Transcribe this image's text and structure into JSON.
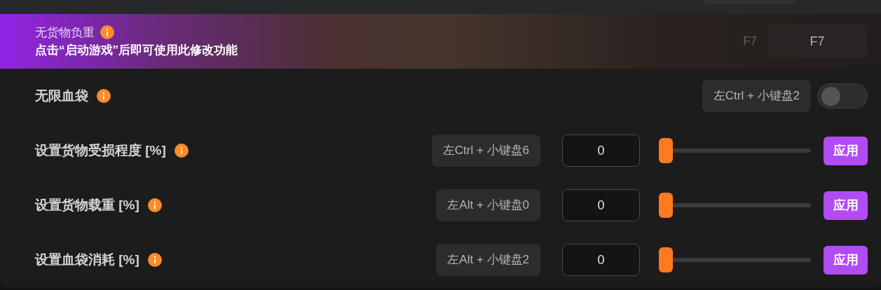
{
  "rows": [
    {
      "kind": "locked",
      "label": "无货物负重",
      "notice": "点击“启动游戏”后即可使用此修改功能",
      "hotkey": "F7",
      "key_button": "F7"
    },
    {
      "kind": "toggle",
      "label": "无限血袋",
      "hotkey": "左Ctrl + 小键盘2",
      "on": false
    },
    {
      "kind": "slider",
      "label": "设置货物受损程度 [%]",
      "hotkey": "左Ctrl + 小键盘6",
      "value": "0",
      "level": 0,
      "button": "应用"
    },
    {
      "kind": "slider",
      "label": "设置货物载重 [%]",
      "hotkey": "左Alt + 小键盘0",
      "value": "0",
      "level": 0,
      "button": "应用"
    },
    {
      "kind": "slider",
      "label": "设置血袋消耗 [%]",
      "hotkey": "左Alt + 小键盘2",
      "value": "0",
      "level": 0,
      "button": "应用"
    }
  ]
}
